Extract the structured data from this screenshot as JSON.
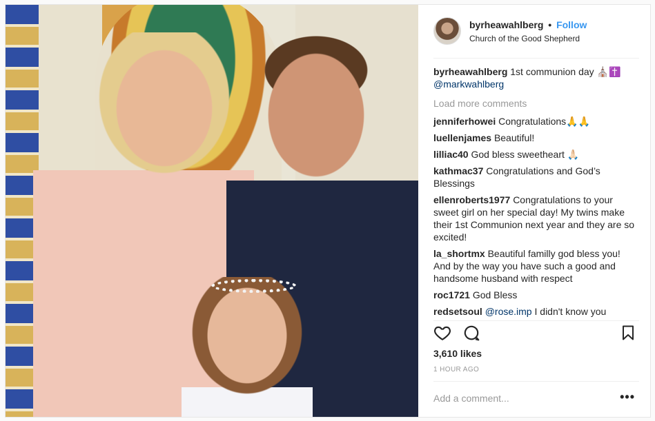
{
  "post": {
    "username": "byrheawahlberg",
    "separator": "•",
    "follow_label": "Follow",
    "location": "Church of the Good Shepherd",
    "caption": {
      "username": "byrheawahlberg",
      "text": "1st communion day ⛪✝️",
      "mention": "@markwahlberg"
    },
    "load_more_label": "Load more comments",
    "comments": [
      {
        "user": "jenniferhowei",
        "text": "Congratulations🙏🙏"
      },
      {
        "user": "luellenjames",
        "text": "Beautiful!"
      },
      {
        "user": "lilliac40",
        "text": "God bless sweetheart 🙏🏻"
      },
      {
        "user": "kathmac37",
        "text": "Congratulations and God’s Blessings"
      },
      {
        "user": "ellenroberts1977",
        "text": "Congratulations to your sweet girl on her special day! My twins make their 1st Communion next year and they are so excited!"
      },
      {
        "user": "la_shortmx",
        "text": "Beautiful familly god bless you! And by the way you have such a good and handsome husband with respect"
      },
      {
        "user": "roc1721",
        "text": "God Bless"
      },
      {
        "user": "redsetsoul",
        "mention": "@rose.imp",
        "text": "I didn't know you"
      }
    ],
    "likes": "3,610 likes",
    "time": "1 HOUR AGO",
    "add_comment_placeholder": "Add a comment...",
    "more_label": "•••"
  },
  "icons": {
    "like": "heart-icon",
    "comment": "speech-bubble-icon",
    "save": "bookmark-icon"
  }
}
